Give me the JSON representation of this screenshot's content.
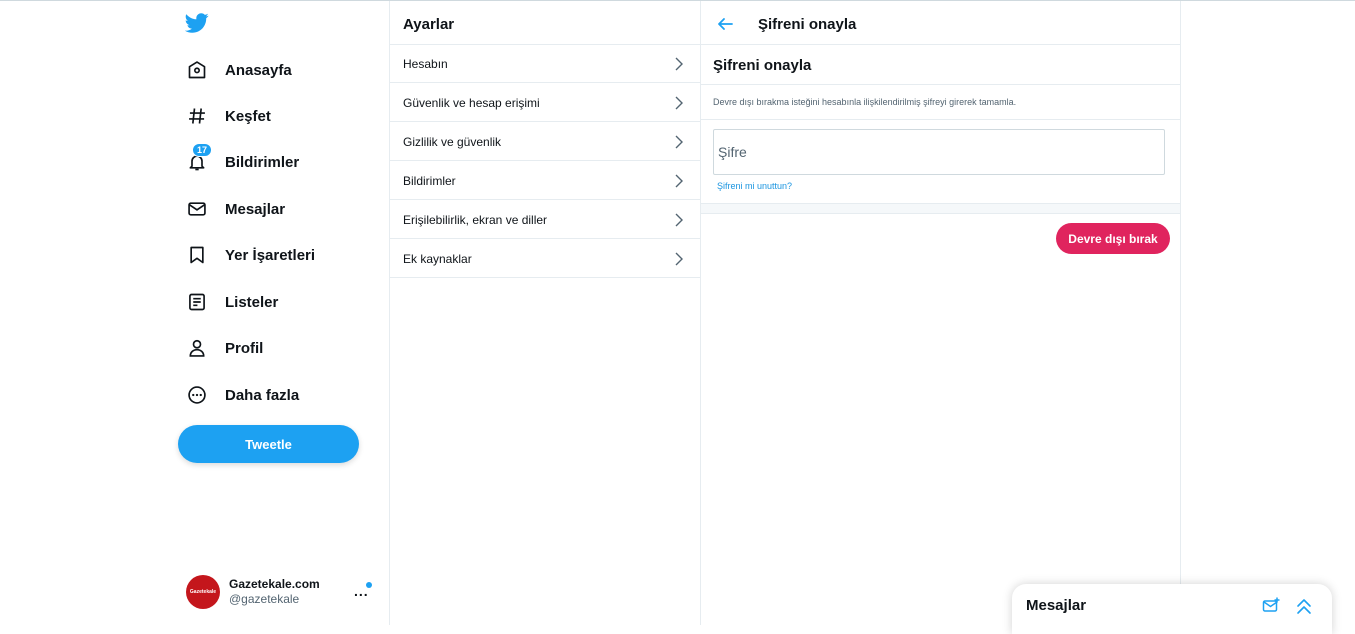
{
  "nav": {
    "items": [
      {
        "icon": "home-icon",
        "label": "Anasayfa"
      },
      {
        "icon": "hashtag-icon",
        "label": "Keşfet"
      },
      {
        "icon": "bell-icon",
        "label": "Bildirimler"
      },
      {
        "icon": "mail-icon",
        "label": "Mesajlar"
      },
      {
        "icon": "bookmark-icon",
        "label": "Yer İşaretleri"
      },
      {
        "icon": "list-icon",
        "label": "Listeler"
      },
      {
        "icon": "profile-icon",
        "label": "Profil"
      },
      {
        "icon": "more-circle-icon",
        "label": "Daha fazla"
      }
    ],
    "notification_count": "17",
    "tweet_label": "Tweetle"
  },
  "account": {
    "avatar_text": "Gazetekale",
    "name": "Gazetekale.com",
    "handle": "@gazetekale",
    "more": "..."
  },
  "settings": {
    "title": "Ayarlar",
    "items": [
      "Hesabın",
      "Güvenlik ve hesap erişimi",
      "Gizlilik ve güvenlik",
      "Bildirimler",
      "Erişilebilirlik, ekran ve diller",
      "Ek kaynaklar"
    ]
  },
  "confirm": {
    "header_title": "Şifreni onayla",
    "section_title": "Şifreni onayla",
    "description": "Devre dışı bırakma isteğini hesabınla ilişkilendirilmiş şifreyi girerek tamamla.",
    "password_placeholder": "Şifre",
    "password_value": "",
    "forgot_link": "Şifreni mi unuttun?",
    "disable_button": "Devre dışı bırak"
  },
  "dock": {
    "title": "Mesajlar"
  },
  "colors": {
    "brand": "#1da1f2",
    "danger": "#e0245e",
    "text": "#0f1419",
    "muted": "#536471"
  }
}
